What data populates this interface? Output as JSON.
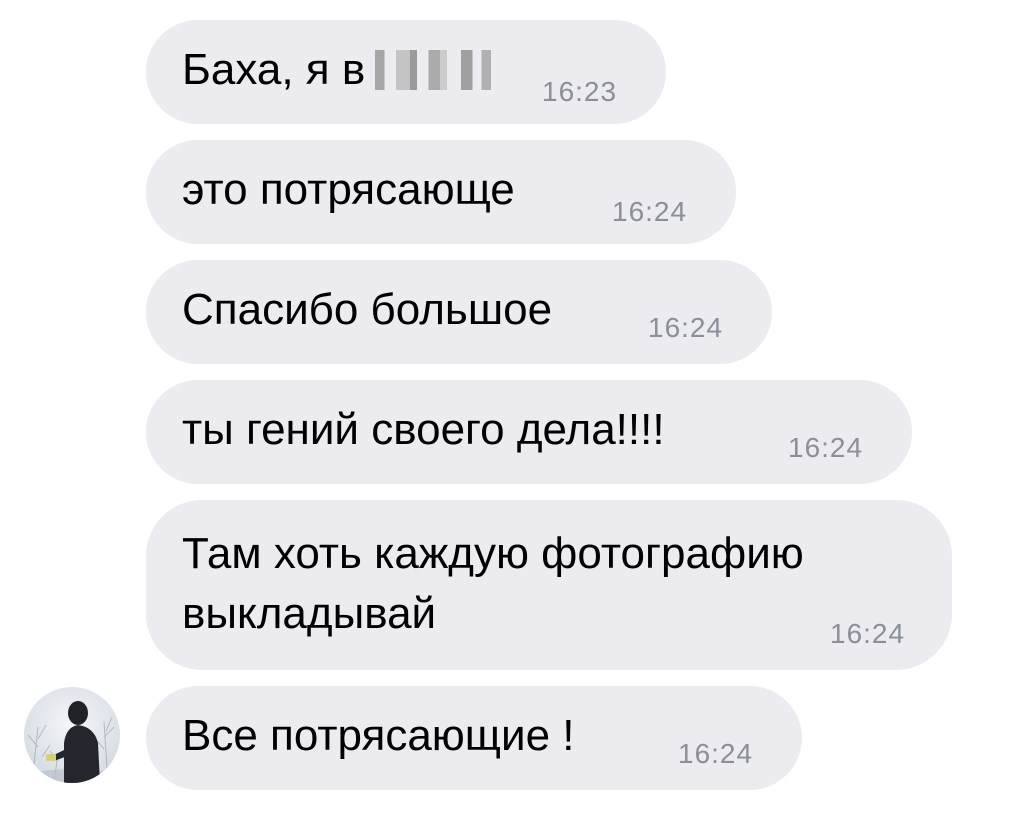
{
  "messages": [
    {
      "text": "Баха, я в",
      "time": "16:23",
      "has_redaction": true
    },
    {
      "text": "это потрясающе",
      "time": "16:24"
    },
    {
      "text": "Спасибо большое",
      "time": "16:24"
    },
    {
      "text": "ты гений своего дела!!!!",
      "time": "16:24"
    },
    {
      "text_line1": "Там хоть каждую фотографию",
      "text_line2": "выкладывай",
      "time": "16:24"
    },
    {
      "text": "Все потрясающие !",
      "time": "16:24"
    }
  ],
  "sender": {
    "avatar_icon": "person-silhouette-avatar"
  },
  "colors": {
    "bubble": "#ebebf0",
    "time": "#8a8f99",
    "text": "#000000"
  }
}
